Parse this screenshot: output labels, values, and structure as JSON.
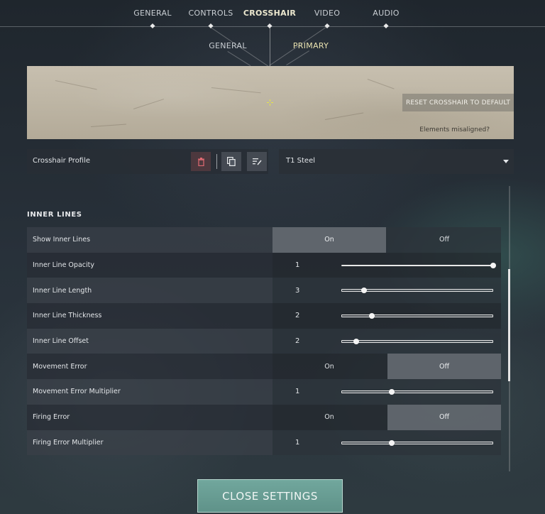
{
  "nav": {
    "tabs": [
      {
        "label": "GENERAL",
        "active": false
      },
      {
        "label": "CONTROLS",
        "active": false
      },
      {
        "label": "CROSSHAIR",
        "active": true
      },
      {
        "label": "VIDEO",
        "active": false
      },
      {
        "label": "AUDIO",
        "active": false
      }
    ],
    "subtabs": [
      {
        "label": "GENERAL",
        "active": false
      },
      {
        "label": "PRIMARY",
        "active": true
      }
    ]
  },
  "preview": {
    "reset_label": "RESET CROSSHAIR TO DEFAULT",
    "misaligned_label": "Elements misaligned?",
    "crosshair_color": "#e6e645"
  },
  "profile": {
    "label": "Crosshair Profile",
    "selected": "T1 Steel",
    "icons": [
      "trash-icon",
      "copy-icon",
      "rename-icon",
      "chevron-down-icon"
    ]
  },
  "section": {
    "title": "INNER LINES",
    "rows": [
      {
        "label": "Show Inner Lines",
        "type": "toggle",
        "on_label": "On",
        "off_label": "Off",
        "selected": "On"
      },
      {
        "label": "Inner Line Opacity",
        "type": "slider",
        "value": "1",
        "fraction": 1.0
      },
      {
        "label": "Inner Line Length",
        "type": "slider",
        "value": "3",
        "fraction": 0.15
      },
      {
        "label": "Inner Line Thickness",
        "type": "slider",
        "value": "2",
        "fraction": 0.2
      },
      {
        "label": "Inner Line Offset",
        "type": "slider",
        "value": "2",
        "fraction": 0.1
      },
      {
        "label": "Movement Error",
        "type": "toggle",
        "on_label": "On",
        "off_label": "Off",
        "selected": "Off"
      },
      {
        "label": "Movement Error Multiplier",
        "type": "slider",
        "value": "1",
        "fraction": 0.33
      },
      {
        "label": "Firing Error",
        "type": "toggle",
        "on_label": "On",
        "off_label": "Off",
        "selected": "Off"
      },
      {
        "label": "Firing Error Multiplier",
        "type": "slider",
        "value": "1",
        "fraction": 0.33
      }
    ]
  },
  "close_label": "CLOSE SETTINGS",
  "accent_color": "#6aa096"
}
